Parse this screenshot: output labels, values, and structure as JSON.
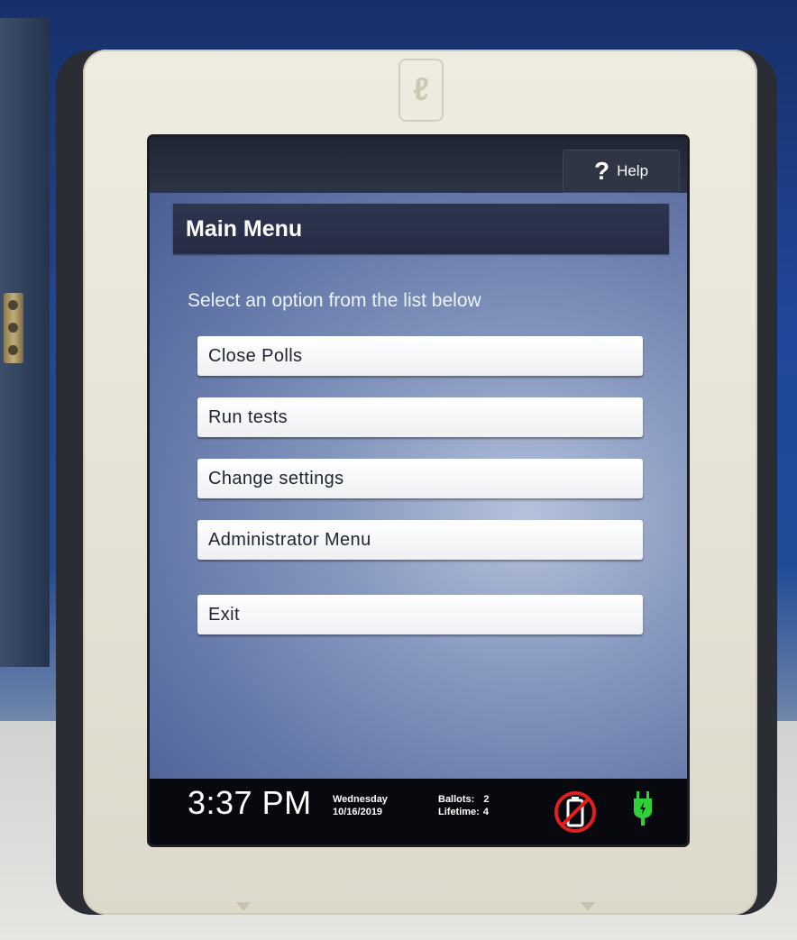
{
  "header": {
    "help_label": "Help"
  },
  "main": {
    "title": "Main Menu",
    "instruction": "Select an option from the list below",
    "options": [
      "Close Polls",
      "Run tests",
      "Change settings",
      "Administrator Menu",
      "Exit"
    ]
  },
  "status": {
    "time": "3:37 PM",
    "day": "Wednesday",
    "date": "10/16/2019",
    "ballots_label": "Ballots:",
    "ballots_value": "2",
    "lifetime_label": "Lifetime:",
    "lifetime_value": "4"
  },
  "icons": {
    "help": "question-mark-icon",
    "battery": "no-battery-icon",
    "power": "power-plug-icon"
  },
  "colors": {
    "plug_green": "#2fcf3a",
    "no_battery_red": "#e02020",
    "title_bar": "#2a3149",
    "button_bg": "#ffffff"
  }
}
